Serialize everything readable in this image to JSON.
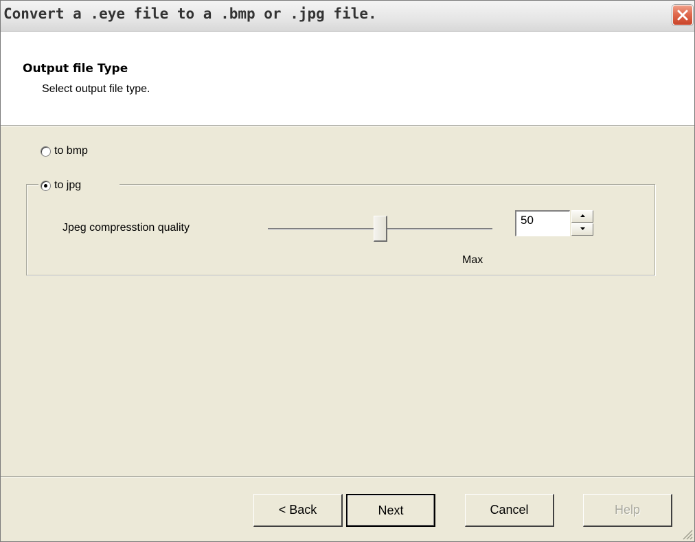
{
  "window": {
    "title": "Convert a .eye file to a .bmp or .jpg file."
  },
  "header": {
    "title": "Output file Type",
    "subtitle": "Select output file type."
  },
  "options": {
    "bmp_label": "to bmp",
    "jpg_label": "to jpg",
    "selected": "to jpg"
  },
  "jpeg": {
    "quality_label": "Jpeg compresstion quality",
    "slider_level": 0.5,
    "max_label": "Max",
    "quality_value": "50"
  },
  "buttons": {
    "back": "< Back",
    "next": "Next",
    "cancel": "Cancel",
    "help": "Help"
  },
  "colors": {
    "dialog_bg": "#ece9d8",
    "header_bg": "#ffffff",
    "close_button": "#e06a4e"
  },
  "icons": [
    "close-icon",
    "spin-up-icon",
    "spin-down-icon",
    "resize-grip-icon"
  ]
}
